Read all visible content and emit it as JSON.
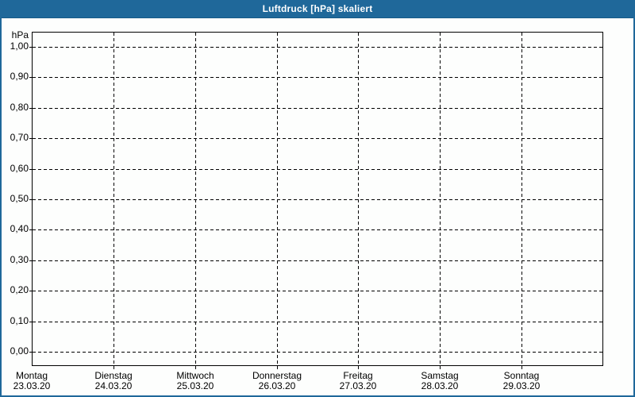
{
  "window": {
    "title": "Luftdruck [hPa] skaliert"
  },
  "colors": {
    "titlebar_bg": "#1f689a",
    "titlebar_text": "#ffffff",
    "window_border": "#1f689a",
    "canvas_bg": "#fdfefd",
    "plot_border": "#000000",
    "grid": "#000000",
    "label_text": "#000000"
  },
  "chart_data": {
    "type": "line",
    "title": "Luftdruck [hPa] skaliert",
    "unit_label": "hPa",
    "ylabel": "hPa",
    "ylim": [
      0.0,
      1.0
    ],
    "y_tick_step": 0.1,
    "grid": "dashed, both axes",
    "legend": "none",
    "y_ticks": [
      {
        "value": 1.0,
        "label": "1,00"
      },
      {
        "value": 0.9,
        "label": "0,90"
      },
      {
        "value": 0.8,
        "label": "0,80"
      },
      {
        "value": 0.7,
        "label": "0,70"
      },
      {
        "value": 0.6,
        "label": "0,60"
      },
      {
        "value": 0.5,
        "label": "0,50"
      },
      {
        "value": 0.4,
        "label": "0,40"
      },
      {
        "value": 0.3,
        "label": "0,30"
      },
      {
        "value": 0.2,
        "label": "0,20"
      },
      {
        "value": 0.1,
        "label": "0,10"
      },
      {
        "value": 0.0,
        "label": "0,00"
      }
    ],
    "categories": [
      {
        "day": "Montag",
        "date": "23.03.20"
      },
      {
        "day": "Dienstag",
        "date": "24.03.20"
      },
      {
        "day": "Mittwoch",
        "date": "25.03.20"
      },
      {
        "day": "Donnerstag",
        "date": "26.03.20"
      },
      {
        "day": "Freitag",
        "date": "27.03.20"
      },
      {
        "day": "Samstag",
        "date": "28.03.20"
      },
      {
        "day": "Sonntag",
        "date": "29.03.20"
      }
    ],
    "series": []
  }
}
